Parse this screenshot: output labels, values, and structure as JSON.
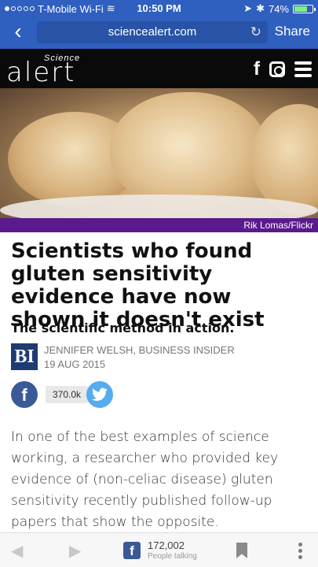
{
  "status_bar": {
    "carrier": "T-Mobile Wi-Fi",
    "time": "10:50 PM",
    "battery": "74%",
    "battery_level": 0.74
  },
  "browser": {
    "url": "sciencealert.com",
    "share_label": "Share"
  },
  "site": {
    "logo_top": "Science",
    "logo_main": "alert"
  },
  "hero": {
    "credit": "Rik Lomas/Flickr"
  },
  "article": {
    "headline": "Scientists who found gluten sensitivity evidence have now shown it doesn't exist",
    "subhead": "The scientific method in action.",
    "source_logo": "BI",
    "author": "JENNIFER WELSH, BUSINESS INSIDER",
    "date": "19 AUG 2015",
    "share_count": "370.0k",
    "body": "In one of the best examples of science working, a researcher who provided key evidence of (non-celiac disease) gluten sensitivity recently published follow-up papers that show the opposite."
  },
  "bottom_bar": {
    "talk_count": "172,002",
    "talk_label": "People talking"
  },
  "icons": {
    "back": "chevron-left-icon",
    "reload": "reload-icon",
    "facebook": "facebook-icon",
    "instagram": "instagram-icon",
    "menu": "hamburger-menu-icon",
    "twitter": "twitter-icon",
    "bookmark": "bookmark-icon",
    "more": "more-vertical-icon"
  },
  "colors": {
    "browser_bar": "#2f5fbf",
    "site_header": "#0a0a0a",
    "credit_bar": "#5a1a8c",
    "facebook": "#3b5998",
    "twitter": "#55acee"
  }
}
